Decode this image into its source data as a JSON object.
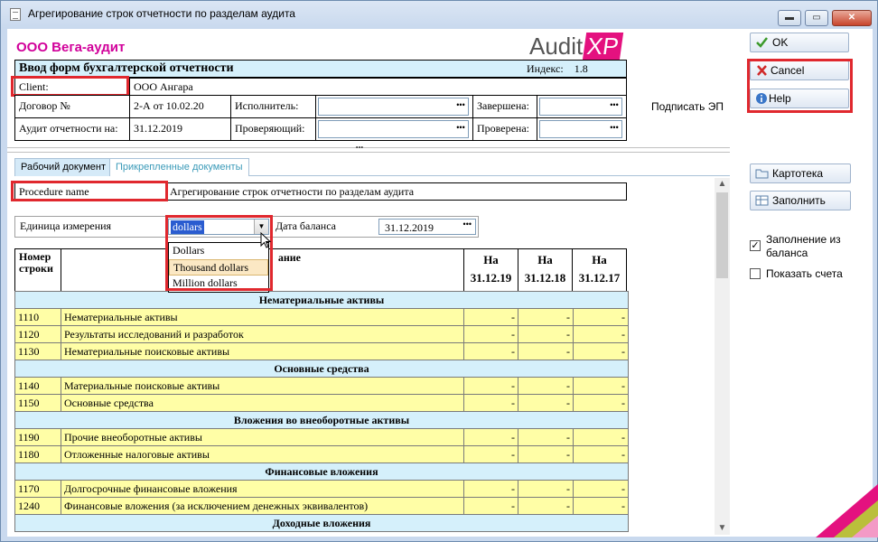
{
  "window": {
    "title": "Агрегирование строк отчетности по разделам аудита",
    "minimize": "▬",
    "maximize": "▭",
    "close": "✕"
  },
  "company": "ООО Вега-аудит",
  "logo": {
    "left": "Audit",
    "right": "XP"
  },
  "form": {
    "title": "Ввод форм бухгалтерской отчетности",
    "index_label": "Индекс:",
    "index_value": "1.8",
    "client_label": "Client:",
    "client_value": "ООО Ангара",
    "contract_label": "Договор №",
    "contract_value": "2-А от 10.02.20",
    "executor_label": "Исполнитель:",
    "executor_value": "",
    "completed_label": "Завершена:",
    "completed_value": "",
    "audit_label": "Аудит отчетности на:",
    "audit_value": "31.12.2019",
    "reviewer_label": "Проверяющий:",
    "reviewer_value": "",
    "checked_label": "Проверена:",
    "checked_value": "",
    "dots": "•••"
  },
  "sign_label": "Подписать ЭП",
  "tabs": [
    {
      "label": "Рабочий документ"
    },
    {
      "label": "Прикрепленные документы"
    }
  ],
  "procedure": {
    "label": "Procedure name",
    "value": "Агрегирование строк отчетности по разделам аудита"
  },
  "unit": {
    "label": "Единица измерения",
    "value": "dollars",
    "options": [
      "Dollars",
      "Thousand dollars",
      "Million dollars"
    ],
    "highlighted": "Thousand dollars"
  },
  "balance_date": {
    "label": "Дата баланса",
    "value": "31.12.2019"
  },
  "table": {
    "col_num": "Номер строки",
    "col_name": "ание",
    "col_na": "На",
    "dates": [
      "31.12.19",
      "31.12.18",
      "31.12.17"
    ],
    "sections": [
      {
        "title": "Нематериальные активы",
        "rows": [
          {
            "code": "1110",
            "name": "Нематериальные активы"
          },
          {
            "code": "1120",
            "name": "Результаты исследований и разработок"
          },
          {
            "code": "1130",
            "name": "Нематериальные поисковые активы"
          }
        ]
      },
      {
        "title": "Основные средства",
        "rows": [
          {
            "code": "1140",
            "name": "Материальные поисковые активы"
          },
          {
            "code": "1150",
            "name": "Основные средства"
          }
        ]
      },
      {
        "title": "Вложения во внеоборотные активы",
        "rows": [
          {
            "code": "1190",
            "name": "Прочие внеоборотные активы"
          },
          {
            "code": "1180",
            "name": "Отложенные налоговые активы"
          }
        ]
      },
      {
        "title": "Финансовые вложения",
        "rows": [
          {
            "code": "1170",
            "name": "Долгосрочные финансовые вложения"
          },
          {
            "code": "1240",
            "name": "Финансовые вложения (за исключением денежных эквивалентов)"
          }
        ]
      },
      {
        "title": "Доходные вложения",
        "rows": []
      }
    ],
    "empty_value": "-"
  },
  "sidebar": {
    "ok": "OK",
    "cancel": "Cancel",
    "help": "Help",
    "cardfile": "Картотека",
    "fill": "Заполнить",
    "fill_from_balance": "Заполнение из баланса",
    "fill_checked": true,
    "show_accounts": "Показать счета",
    "show_checked": false
  },
  "colors": {
    "accent": "#e4117f",
    "highlight": "#e0282e",
    "cell_yellow": "#fffea6",
    "header_blue": "#d5f0fb"
  }
}
